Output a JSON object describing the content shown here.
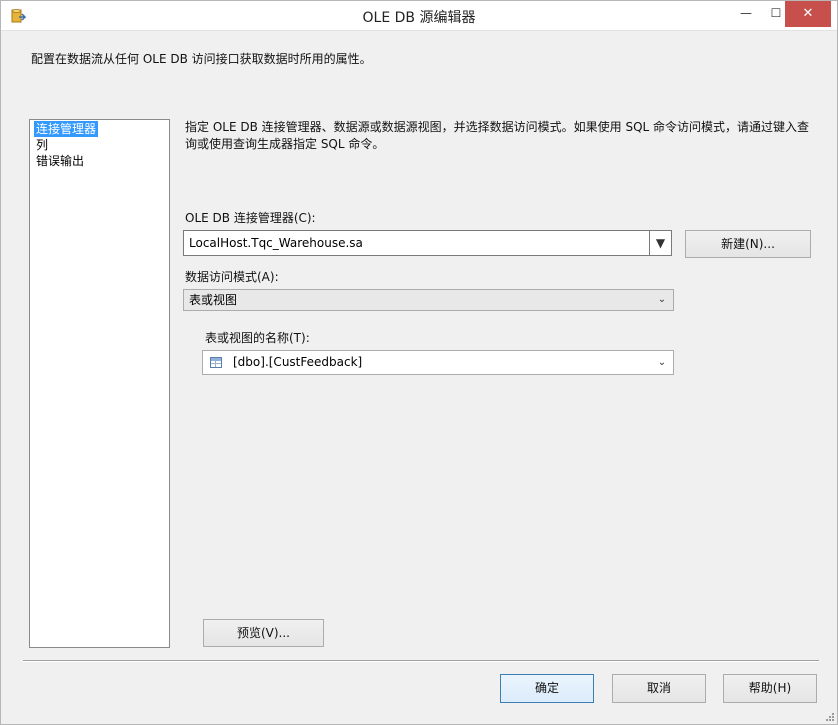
{
  "window": {
    "title": "OLE DB 源编辑器",
    "minimize_glyph": "—",
    "maximize_glyph": "☐",
    "close_glyph": "✕",
    "app_icon": "ssis-source-icon"
  },
  "description": "配置在数据流从任何 OLE DB 访问接口获取数据时所用的属性。",
  "nav": {
    "items": [
      {
        "label": "连接管理器",
        "selected": true
      },
      {
        "label": "列",
        "selected": false
      },
      {
        "label": "错误输出",
        "selected": false
      }
    ]
  },
  "main": {
    "instructions": "指定 OLE DB 连接管理器、数据源或数据源视图，并选择数据访问模式。如果使用 SQL 命令访问模式，请通过键入查询或使用查询生成器指定 SQL 命令。",
    "connection_manager_label": "OLE DB 连接管理器(C):",
    "connection_manager_value": "LocalHost.Tqc_Warehouse.sa",
    "new_button": "新建(N)...",
    "access_mode_label": "数据访问模式(A):",
    "access_mode_value": "表或视图",
    "table_name_label": "表或视图的名称(T):",
    "table_name_value": "[dbo].[CustFeedback]",
    "preview_button": "预览(V)..."
  },
  "footer": {
    "ok_button": "确定",
    "cancel_button": "取消",
    "help_button": "帮助(H)"
  },
  "colors": {
    "selection": "#3399ff",
    "close_button": "#c7504c"
  }
}
